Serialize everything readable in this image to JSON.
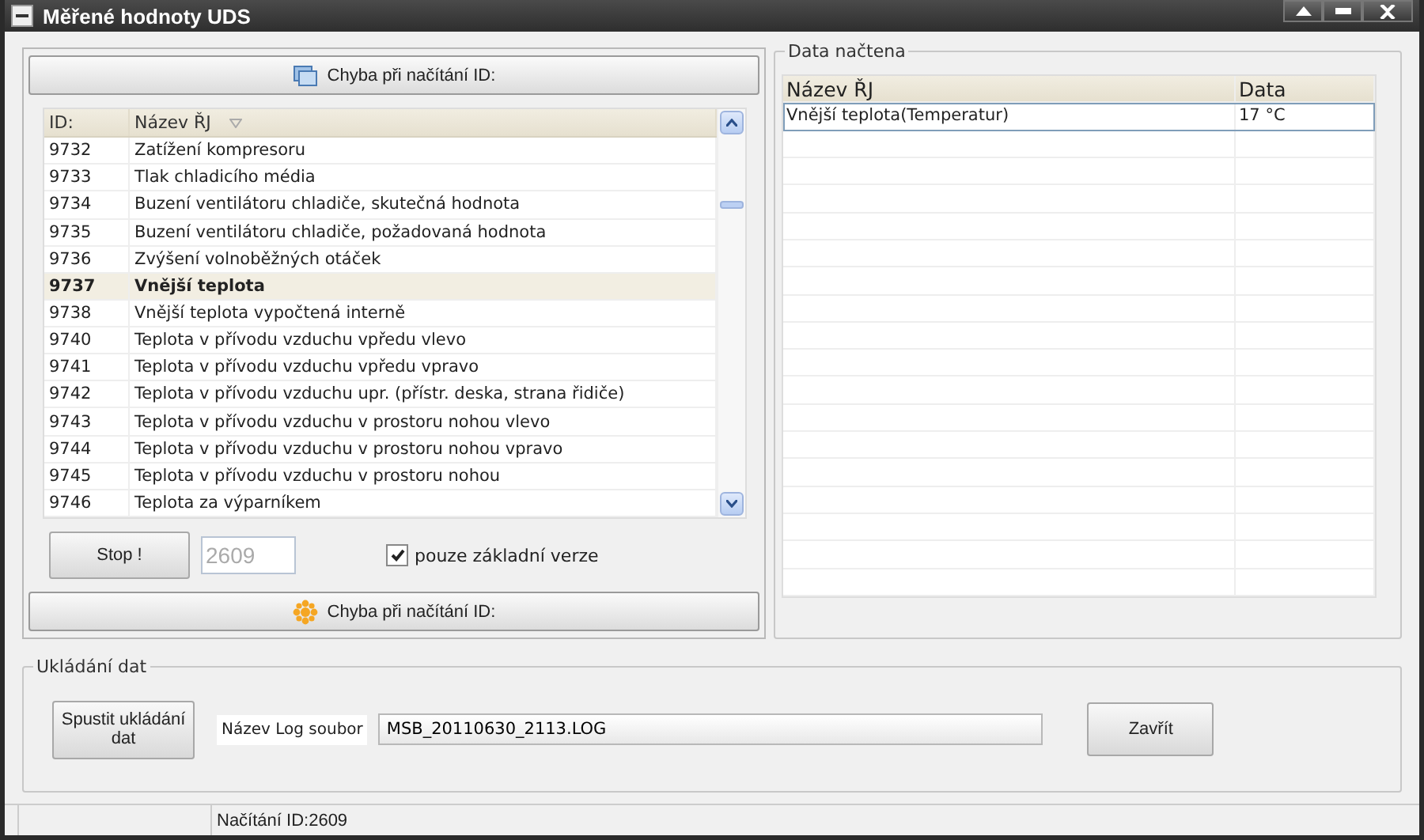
{
  "window": {
    "title": "Měřené hodnoty UDS"
  },
  "left_panel": {
    "top_button": {
      "label": "Chyba při načítání ID:"
    },
    "list": {
      "columns": [
        "ID:",
        "Název ŘJ"
      ],
      "rows": [
        {
          "id": "9732",
          "name": "Zatížení kompresoru",
          "selected": false
        },
        {
          "id": "9733",
          "name": "Tlak chladicího média",
          "selected": false
        },
        {
          "id": "9734",
          "name": "Buzení ventilátoru chladiče, skutečná hodnota",
          "selected": false
        },
        {
          "id": "9735",
          "name": "Buzení ventilátoru chladiče, požadovaná hodnota",
          "selected": false
        },
        {
          "id": "9736",
          "name": "Zvýšení volnoběžných otáček",
          "selected": false
        },
        {
          "id": "9737",
          "name": "Vnější teplota",
          "selected": true
        },
        {
          "id": "9738",
          "name": "Vnější teplota vypočtená interně",
          "selected": false
        },
        {
          "id": "9740",
          "name": "Teplota v přívodu vzduchu vpředu vlevo",
          "selected": false
        },
        {
          "id": "9741",
          "name": "Teplota v přívodu vzduchu vpředu vpravo",
          "selected": false
        },
        {
          "id": "9742",
          "name": "Teplota v přívodu vzduchu upr. (přístr. deska, strana řidiče)",
          "selected": false
        },
        {
          "id": "9743",
          "name": "Teplota v přívodu vzduchu v prostoru nohou vlevo",
          "selected": false
        },
        {
          "id": "9744",
          "name": "Teplota v přívodu vzduchu v prostoru nohou vpravo",
          "selected": false
        },
        {
          "id": "9745",
          "name": "Teplota v přívodu vzduchu v prostoru nohou",
          "selected": false
        },
        {
          "id": "9746",
          "name": "Teplota za výparníkem",
          "selected": false
        }
      ]
    },
    "stop_button": {
      "label": "Stop !"
    },
    "counter_field": {
      "value": "2609",
      "disabled": true
    },
    "basic_version_checkbox": {
      "label": "pouze základní verze",
      "checked": true
    },
    "bottom_button": {
      "label": "Chyba při načítání ID:"
    }
  },
  "data_panel": {
    "title": "Data načtena",
    "columns": [
      "Název ŘJ",
      "Data"
    ],
    "rows": [
      {
        "name": "Vnější teplota(Temperatur)",
        "value": "17 °C",
        "selected": true
      }
    ]
  },
  "save_panel": {
    "title": "Ukládání dat",
    "start_button": {
      "label": "Spustit ukládání dat"
    },
    "log_label": "Název Log soubor",
    "log_field": {
      "value": "MSB_20110630_2113.LOG"
    },
    "close_button": {
      "label": "Zavřít"
    }
  },
  "status_bar": {
    "text": "Načítání ID:2609"
  }
}
